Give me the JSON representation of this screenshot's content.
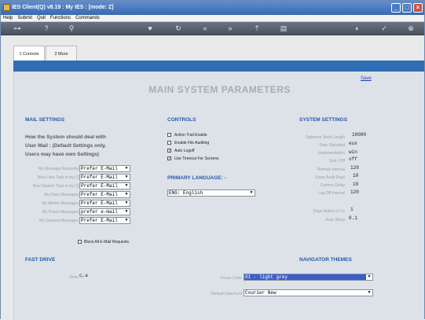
{
  "window": {
    "title": "IES Client(Q) v8.19 : My IES :  [mode: Z]"
  },
  "menu": [
    "Help",
    "Submit",
    "Quit",
    "Functions",
    "Commands"
  ],
  "tabs": [
    {
      "label": "1 Controls"
    },
    {
      "label": "2 More"
    }
  ],
  "save_label": "Save",
  "page_title": "MAIN SYSTEM PARAMETERS",
  "mail": {
    "heading": "MAIL SETTINGS",
    "desc1": "How the System should deal with",
    "desc2": "User Mail :  (Default Settings only,",
    "desc3": "Users may have own Settings)",
    "rows": [
      {
        "label": "My Message Requests",
        "value": "Prefer E-Mail"
      },
      {
        "label": "New User Task in my Q",
        "value": "Prefer E-Mail"
      },
      {
        "label": "New System Task in my Q",
        "value": "Prefer E-Mail"
      },
      {
        "label": "My Diary Messages",
        "value": "Prefer E-Mail"
      },
      {
        "label": "My Alerter Messages",
        "value": "Prefer E-Mail"
      },
      {
        "label": "My Punch Messages",
        "value": "prefer e-mail"
      },
      {
        "label": "My General Messages",
        "value": "Prefer E-Mail"
      }
    ],
    "block_label": "Block All E-Mail Requests"
  },
  "controls": {
    "heading": "CONTROLS",
    "items": [
      {
        "label": "Action Trail Enable",
        "checked": false
      },
      {
        "label": "Enable File Auditing",
        "checked": false
      },
      {
        "label": "Auto Logoff",
        "checked": true
      },
      {
        "label": "Use Timeout For Screens",
        "checked": true
      }
    ],
    "lang_heading": "PRIMARY LANGUAGE: -",
    "lang_value": "ENG: English"
  },
  "system": {
    "heading": "SYSTEM SETTINGS",
    "rows": [
      {
        "label": "Optimum Send Length",
        "value": "10000"
      },
      {
        "label": "Date Standard",
        "value": "eux"
      },
      {
        "label": "Implementation",
        "value": "win"
      },
      {
        "label": "Exit / Off",
        "value": "off"
      },
      {
        "label": "Refresh Interval",
        "value": "120"
      },
      {
        "label": "Keep Audit Days",
        "value": "10"
      },
      {
        "label": "Comms Delay",
        "value": "10"
      },
      {
        "label": "Log Off Interval",
        "value": "120"
      }
    ],
    "notice_label": "Days Notice of Lic",
    "notice_value": "1",
    "autosleep_label": "Auto Sleep",
    "autosleep_value": "0.1"
  },
  "fastdrive": {
    "heading": "FAST DRIVE",
    "label": "Drive",
    "value": "c,a"
  },
  "navigator": {
    "heading": "NAVIGATOR THEMES",
    "focus_label": "Focus Color",
    "focus_value": "01 - light grey",
    "font_label": "Default Data Font",
    "font_value": "Courier New"
  }
}
